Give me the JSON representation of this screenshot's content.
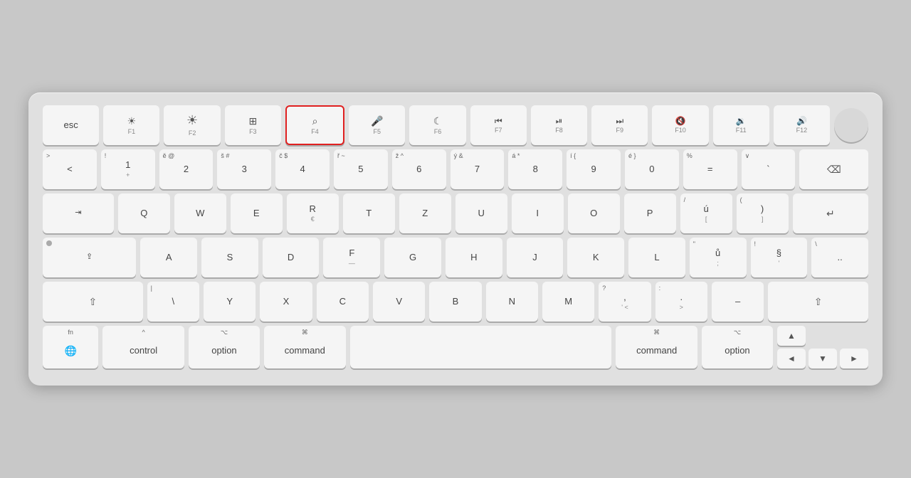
{
  "keyboard": {
    "rows": [
      {
        "id": "function-row",
        "keys": [
          {
            "id": "esc",
            "main": "esc",
            "sub": "",
            "top": "",
            "wide": "normal"
          },
          {
            "id": "f1",
            "main": "☀",
            "sub": "F1",
            "top": "",
            "wide": "normal"
          },
          {
            "id": "f2",
            "main": "☀",
            "sub": "F2",
            "top": "",
            "wide": "normal",
            "mainBright": true
          },
          {
            "id": "f3",
            "main": "⊞",
            "sub": "F3",
            "top": "",
            "wide": "normal"
          },
          {
            "id": "f4",
            "main": "⌕",
            "sub": "F4",
            "top": "",
            "wide": "normal",
            "highlighted": true
          },
          {
            "id": "f5",
            "main": "🎤",
            "sub": "F5",
            "top": "",
            "wide": "normal"
          },
          {
            "id": "f6",
            "main": "☾",
            "sub": "F6",
            "top": "",
            "wide": "normal"
          },
          {
            "id": "f7",
            "main": "◄◄",
            "sub": "F7",
            "top": "",
            "wide": "normal"
          },
          {
            "id": "f8",
            "main": "▶⏸",
            "sub": "F8",
            "top": "",
            "wide": "normal"
          },
          {
            "id": "f9",
            "main": "▶▶",
            "sub": "F9",
            "top": "",
            "wide": "normal"
          },
          {
            "id": "f10",
            "main": "◁",
            "sub": "F10",
            "top": "",
            "wide": "normal"
          },
          {
            "id": "f11",
            "main": "◁▷",
            "sub": "F11",
            "top": "",
            "wide": "normal"
          },
          {
            "id": "f12",
            "main": "▷▷",
            "sub": "F12",
            "top": "",
            "wide": "normal"
          },
          {
            "id": "power",
            "main": "",
            "sub": "",
            "top": "",
            "wide": "power"
          }
        ]
      },
      {
        "id": "number-row",
        "keys": [
          {
            "id": "backtick",
            "topLeft": ">",
            "main": "<",
            "wide": "normal"
          },
          {
            "id": "1",
            "topLeft": "!",
            "main": "1",
            "sub": "+",
            "wide": "normal"
          },
          {
            "id": "2",
            "topLeft": "ě",
            "main": "2",
            "sub": "@",
            "wide": "normal"
          },
          {
            "id": "3",
            "topLeft": "š",
            "main": "3",
            "sub": "#",
            "wide": "normal"
          },
          {
            "id": "4",
            "topLeft": "č",
            "main": "4",
            "sub": "$",
            "wide": "normal"
          },
          {
            "id": "5",
            "topLeft": "ř",
            "main": "5",
            "sub": "~",
            "wide": "normal"
          },
          {
            "id": "6",
            "topLeft": "ž",
            "main": "6",
            "sub": "^",
            "wide": "normal"
          },
          {
            "id": "7",
            "topLeft": "ý",
            "main": "7",
            "sub": "&",
            "wide": "normal"
          },
          {
            "id": "8",
            "topLeft": "á",
            "main": "8",
            "sub": "*",
            "wide": "normal"
          },
          {
            "id": "9",
            "topLeft": "í",
            "main": "9",
            "sub": "{",
            "wide": "normal"
          },
          {
            "id": "0",
            "topLeft": "é",
            "main": "0",
            "sub": "}",
            "wide": "normal"
          },
          {
            "id": "minus",
            "topLeft": "%",
            "main": "=",
            "wide": "normal"
          },
          {
            "id": "equals",
            "topLeft": "∨",
            "main": "`",
            "wide": "normal"
          },
          {
            "id": "backspace",
            "main": "⌫",
            "wide": "backspace"
          }
        ]
      },
      {
        "id": "tab-row",
        "keys": [
          {
            "id": "tab",
            "main": "→|",
            "wide": "tab"
          },
          {
            "id": "q",
            "main": "Q",
            "wide": "normal"
          },
          {
            "id": "w",
            "main": "W",
            "wide": "normal"
          },
          {
            "id": "e",
            "main": "E",
            "wide": "normal"
          },
          {
            "id": "r",
            "main": "R",
            "sub": "€",
            "wide": "normal"
          },
          {
            "id": "t",
            "main": "T",
            "wide": "normal"
          },
          {
            "id": "z",
            "main": "Z",
            "wide": "normal"
          },
          {
            "id": "u",
            "main": "U",
            "wide": "normal"
          },
          {
            "id": "i",
            "main": "I",
            "wide": "normal"
          },
          {
            "id": "o",
            "main": "O",
            "wide": "normal"
          },
          {
            "id": "p",
            "main": "P",
            "wide": "normal"
          },
          {
            "id": "bracket-open",
            "topLeft": "/",
            "main": "ú",
            "sub": "[",
            "wide": "normal"
          },
          {
            "id": "bracket-close",
            "topLeft": "(",
            "main": ")",
            "sub": "]",
            "wide": "normal"
          },
          {
            "id": "enter",
            "main": "↵",
            "wide": "enter"
          }
        ]
      },
      {
        "id": "caps-row",
        "keys": [
          {
            "id": "caps",
            "topLeft": "•",
            "main": "⇧",
            "wide": "caps"
          },
          {
            "id": "a",
            "main": "A",
            "wide": "normal"
          },
          {
            "id": "s",
            "main": "S",
            "wide": "normal"
          },
          {
            "id": "d",
            "main": "D",
            "wide": "normal"
          },
          {
            "id": "f",
            "main": "F",
            "sub": "—",
            "wide": "normal"
          },
          {
            "id": "g",
            "main": "G",
            "wide": "normal"
          },
          {
            "id": "h",
            "main": "H",
            "wide": "normal"
          },
          {
            "id": "j",
            "main": "J",
            "wide": "normal"
          },
          {
            "id": "k",
            "main": "K",
            "wide": "normal"
          },
          {
            "id": "l",
            "main": "L",
            "wide": "normal"
          },
          {
            "id": "semicolon",
            "topLeft": "\"",
            "main": "ů",
            "sub": ";",
            "wide": "normal"
          },
          {
            "id": "quote",
            "topLeft": "!",
            "main": "§",
            "sub": "'",
            "wide": "normal"
          },
          {
            "id": "backslash",
            "topLeft": "",
            "main": "..",
            "wide": "normal"
          }
        ]
      },
      {
        "id": "shift-row",
        "keys": [
          {
            "id": "shift-left",
            "main": "⇧",
            "wide": "shift-left"
          },
          {
            "id": "pipe",
            "topLeft": "|",
            "main": "\\",
            "wide": "normal"
          },
          {
            "id": "y",
            "main": "Y",
            "wide": "normal"
          },
          {
            "id": "x",
            "main": "X",
            "wide": "normal"
          },
          {
            "id": "c",
            "main": "C",
            "wide": "normal"
          },
          {
            "id": "v",
            "main": "V",
            "wide": "normal"
          },
          {
            "id": "b",
            "main": "B",
            "wide": "normal"
          },
          {
            "id": "n",
            "main": "N",
            "wide": "normal"
          },
          {
            "id": "m",
            "main": "M",
            "wide": "normal"
          },
          {
            "id": "comma",
            "topLeft": "?",
            "main": ",",
            "sub": "'  <",
            "wide": "normal"
          },
          {
            "id": "period",
            "topLeft": ":",
            "main": ".",
            "sub": ">",
            "wide": "normal"
          },
          {
            "id": "slash",
            "main": "–",
            "wide": "normal"
          },
          {
            "id": "shift-right",
            "main": "⇧",
            "wide": "shift-right"
          }
        ]
      },
      {
        "id": "bottom-row",
        "keys": [
          {
            "id": "fn",
            "top": "fn",
            "main": "🌐",
            "wide": "fn"
          },
          {
            "id": "control",
            "top": "^",
            "main": "control",
            "wide": "control"
          },
          {
            "id": "option-left",
            "top": "⌥",
            "main": "option",
            "wide": "option"
          },
          {
            "id": "command-left",
            "top": "⌘",
            "main": "command",
            "wide": "command"
          },
          {
            "id": "space",
            "main": "",
            "wide": "space"
          },
          {
            "id": "command-right",
            "top": "⌘",
            "main": "command",
            "wide": "command"
          },
          {
            "id": "option-right",
            "top": "⌥",
            "main": "option",
            "wide": "option"
          }
        ]
      }
    ]
  }
}
